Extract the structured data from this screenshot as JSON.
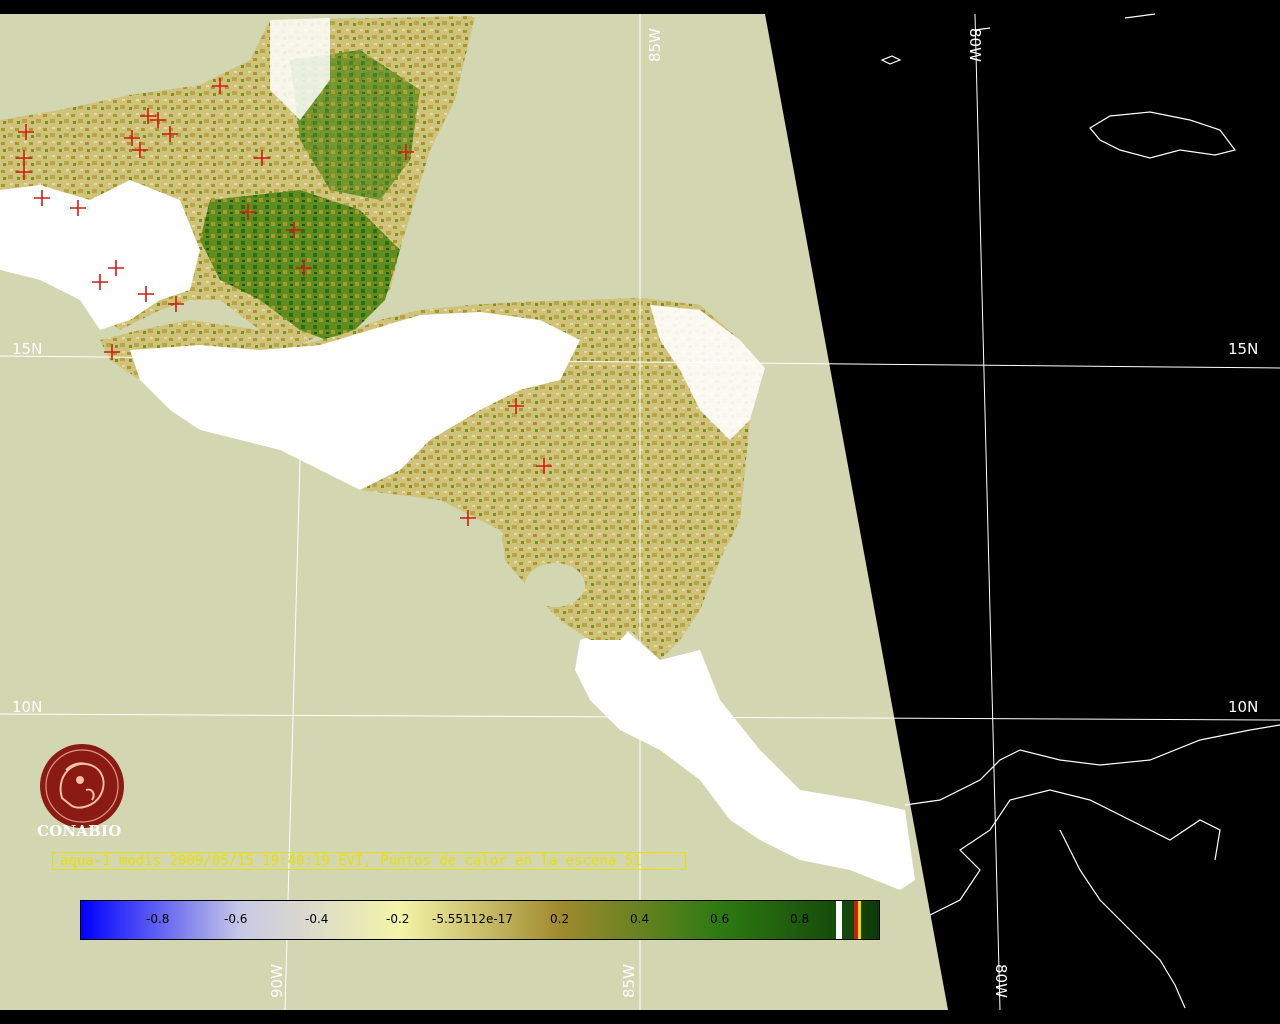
{
  "map": {
    "colors": {
      "ocean": "#d2d6b1",
      "nodata": "#000000",
      "cloud": "#ffffff",
      "grid": "#ffffff",
      "fire": "#d21a12",
      "coast": "#ffffff"
    },
    "grid_labels": {
      "lat_15_left": "15N",
      "lat_15_right": "15N",
      "lat_10_left": "10N",
      "lat_10_right": "10N",
      "lon_85_top": "85W",
      "lon_80_top": "80W",
      "lon_90_bottom": "90W",
      "lon_85_bottom": "85W",
      "lon_80_bottom": "80W"
    }
  },
  "logo": {
    "name": "CONABIO",
    "color": "#8b1a14"
  },
  "caption": {
    "text": "aqua-1 modis 2009/05/15 19:40:19 EVI, Puntos de calor en la escena 51"
  },
  "colorbar": {
    "gradient": [
      "#0000ff",
      "#c8c8e6",
      "#f4f4a8",
      "#a08a2e",
      "#2e7a12",
      "#0e3a08"
    ],
    "ticks": [
      "-0.8",
      "-0.6",
      "-0.4",
      "-0.2",
      "-5.55112e-17",
      "0.2",
      "0.4",
      "0.6",
      "0.8"
    ]
  }
}
